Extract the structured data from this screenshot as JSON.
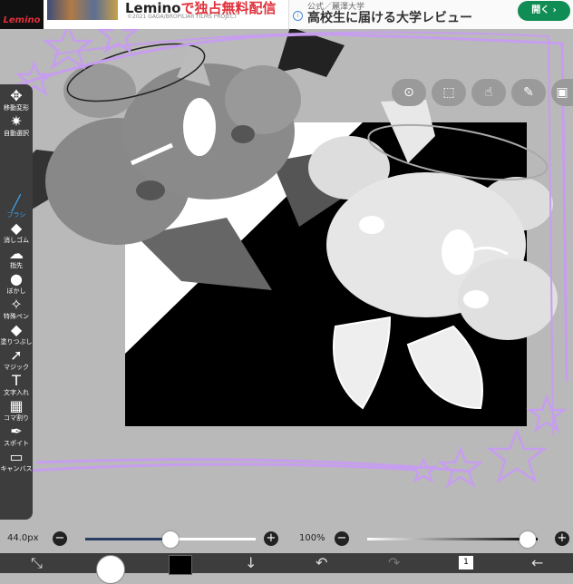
{
  "ad": {
    "logo": "Lemino",
    "headline_prefix": "Lemino",
    "headline_red": "で独占無料配信",
    "small_note": "©2021 GAGA/BROPILIAR FILMS PROJECT",
    "source": "公式／麗澤大学",
    "title": "高校生に届ける大学レビュー",
    "info_icon": "i",
    "open_button": "開く ›"
  },
  "top_tools": [
    {
      "name": "toggle-icon",
      "glyph": "⊙"
    },
    {
      "name": "selection-icon",
      "glyph": "⬚"
    },
    {
      "name": "hand-icon",
      "glyph": "☝"
    },
    {
      "name": "ruler-icon",
      "glyph": "✎"
    },
    {
      "name": "filter-icon",
      "glyph": "▣"
    }
  ],
  "left_tools": [
    {
      "name": "move-transform",
      "icon": "✥",
      "label": "移動変形"
    },
    {
      "name": "auto-select",
      "icon": "✷",
      "label": "自動選択"
    },
    {
      "name": "brush",
      "icon": "╱",
      "label": "ブラシ",
      "active": true
    },
    {
      "name": "eraser",
      "icon": "◆",
      "label": "消しゴム"
    },
    {
      "name": "finger",
      "icon": "☁",
      "label": "指先"
    },
    {
      "name": "blur",
      "icon": "●",
      "label": "ぼかし"
    },
    {
      "name": "special-pen",
      "icon": "✧",
      "label": "特殊ペン"
    },
    {
      "name": "fill",
      "icon": "◆",
      "label": "塗りつぶし"
    },
    {
      "name": "magic",
      "icon": "➚",
      "label": "マジック"
    },
    {
      "name": "text",
      "icon": "T",
      "label": "文字入れ"
    },
    {
      "name": "frame-divider",
      "icon": "▦",
      "label": "コマ割り"
    },
    {
      "name": "eyedropper",
      "icon": "✒",
      "label": "スポイト"
    },
    {
      "name": "canvas",
      "icon": "▭",
      "label": "キャンバス"
    }
  ],
  "brush_size": {
    "label": "44.0px",
    "value_fraction": 0.5
  },
  "opacity": {
    "label": "100%",
    "value_fraction": 1.0
  },
  "actions": {
    "transform_icon": "⤡",
    "down_icon": "↓",
    "undo_icon": "↶",
    "redo_icon": "↷",
    "layer_count": "1",
    "back_icon": "←"
  },
  "colors": {
    "accent": "#3ea4f0",
    "toolbar_bg": "#3d3d3d",
    "ad_button": "#0f8d55",
    "purple_frame": "#c79df0",
    "current_color": "#000000"
  }
}
